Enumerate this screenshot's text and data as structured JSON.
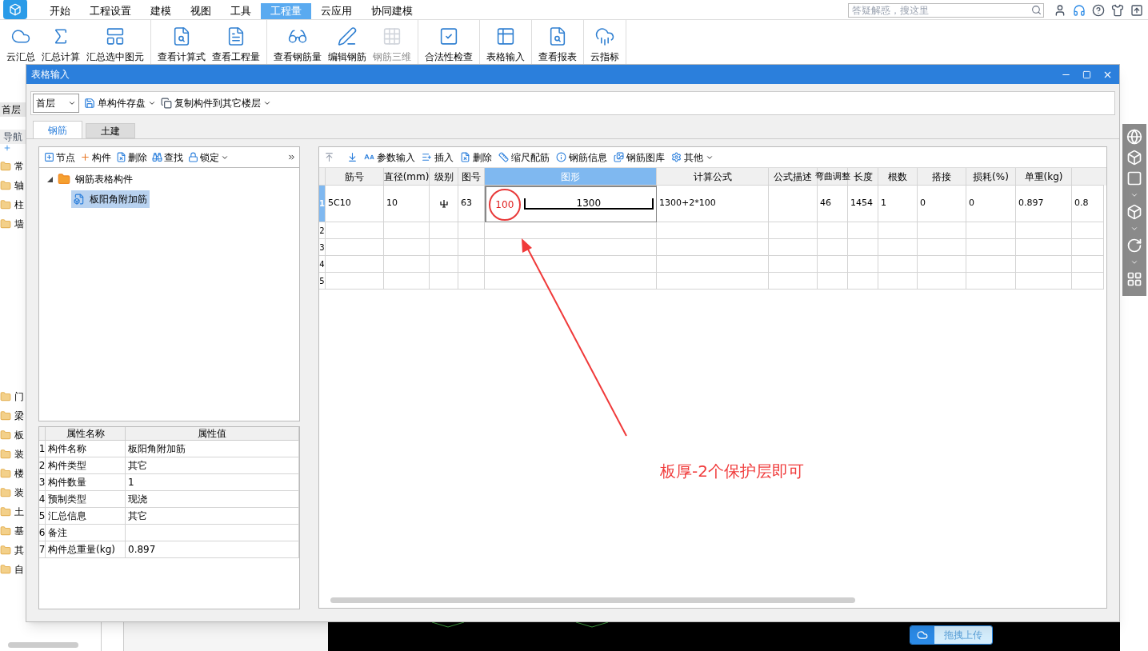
{
  "menu_tabs": [
    {
      "label": "开始",
      "selected": false
    },
    {
      "label": "工程设置",
      "selected": false
    },
    {
      "label": "建模",
      "selected": false
    },
    {
      "label": "视图",
      "selected": false
    },
    {
      "label": "工具",
      "selected": false
    },
    {
      "label": "工程量",
      "selected": true
    },
    {
      "label": "云应用",
      "selected": false
    },
    {
      "label": "协同建模",
      "selected": false
    }
  ],
  "search": {
    "placeholder": "答疑解惑，搜这里"
  },
  "ribbon_groups": [
    [
      {
        "label": "云汇总",
        "disabled": false
      },
      {
        "label": "汇总计算",
        "disabled": false
      },
      {
        "label": "汇总选中图元",
        "disabled": false
      }
    ],
    [
      {
        "label": "查看计算式",
        "disabled": false
      },
      {
        "label": "查看工程量",
        "disabled": false
      }
    ],
    [
      {
        "label": "查看钢筋量",
        "disabled": false
      },
      {
        "label": "编辑钢筋",
        "disabled": false
      },
      {
        "label": "钢筋三维",
        "disabled": true
      }
    ],
    [
      {
        "label": "合法性检查",
        "disabled": false
      }
    ],
    [
      {
        "label": "表格输入",
        "disabled": false
      }
    ],
    [
      {
        "label": "查看报表",
        "disabled": false
      }
    ],
    [
      {
        "label": "云指标",
        "disabled": false
      }
    ]
  ],
  "side_panel": {
    "floor": "首层",
    "header": "导航",
    "items_top": [
      "常",
      "轴",
      "柱",
      "墙"
    ],
    "items_bottom": [
      "门",
      "梁",
      "板",
      "装",
      "楼",
      "装",
      "土",
      "基",
      "其",
      "自"
    ]
  },
  "dialog": {
    "title": "表格输入",
    "floor_select": "首层",
    "toolbar": [
      "单构件存盘",
      "复制构件到其它楼层"
    ],
    "tabs": [
      {
        "label": "钢筋",
        "selected": true
      },
      {
        "label": "土建",
        "selected": false
      }
    ],
    "left_toolbar": [
      "节点",
      "构件",
      "删除",
      "查找",
      "锁定"
    ],
    "tree": [
      {
        "label": "钢筋表格构件",
        "expanded": true,
        "children": [
          {
            "label": "板阳角附加筋",
            "selected": true
          }
        ]
      }
    ],
    "properties": {
      "columns": [
        "属性名称",
        "属性值"
      ],
      "rows": [
        {
          "index": "1",
          "name": "构件名称",
          "value": "板阳角附加筋"
        },
        {
          "index": "2",
          "name": "构件类型",
          "value": "其它"
        },
        {
          "index": "3",
          "name": "构件数量",
          "value": "1"
        },
        {
          "index": "4",
          "name": "预制类型",
          "value": "现浇"
        },
        {
          "index": "5",
          "name": "汇总信息",
          "value": "其它"
        },
        {
          "index": "6",
          "name": "备注"
        },
        {
          "index": "7",
          "name": "构件总重量(kg)",
          "value": "0.897"
        }
      ]
    },
    "grid_toolbar": [
      "参数输入",
      "插入",
      "删除",
      "缩尺配筋",
      "钢筋信息",
      "钢筋图库",
      "其他"
    ],
    "grid": {
      "columns": [
        {
          "label": "筋号",
          "selected": false
        },
        {
          "label": "直径(mm)",
          "selected": false
        },
        {
          "label": "级别",
          "selected": false
        },
        {
          "label": "图号",
          "selected": false
        },
        {
          "label": "图形",
          "selected": true
        },
        {
          "label": "计算公式",
          "selected": false
        },
        {
          "label": "公式描述",
          "selected": false
        },
        {
          "label": "弯曲调整",
          "selected": false
        },
        {
          "label": "长度",
          "selected": false
        },
        {
          "label": "根数",
          "selected": false
        },
        {
          "label": "搭接",
          "selected": false
        },
        {
          "label": "损耗(%)",
          "selected": false
        },
        {
          "label": "单重(kg)",
          "selected": false
        }
      ],
      "rows": [
        {
          "index": "1",
          "selected": true,
          "bar_no": "5C10",
          "diameter": "10",
          "grade_symbol": true,
          "shape_no": "63",
          "shape": {
            "hook": "100",
            "hook_circled": true,
            "length": "1300"
          },
          "cells": [
            "1300+2*100",
            null,
            "46",
            "1454",
            "1",
            "0",
            "0",
            "0.897",
            "0.8"
          ]
        },
        {
          "index": "2",
          "selected": false
        },
        {
          "index": "3",
          "selected": false
        },
        {
          "index": "4",
          "selected": false
        },
        {
          "index": "5",
          "selected": false
        }
      ]
    }
  },
  "annotation": {
    "text": "板厚-2个保护层即可"
  },
  "upload_button": "拖拽上传"
}
